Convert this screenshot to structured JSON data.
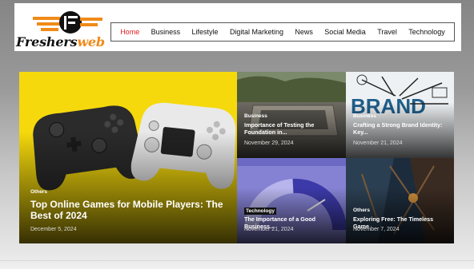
{
  "brand": {
    "name_part1": "Freshers",
    "name_part2": "web"
  },
  "nav": {
    "items": [
      "Home",
      "Business",
      "Lifestyle",
      "Digital Marketing",
      "News",
      "Social Media",
      "Travel",
      "Technology"
    ]
  },
  "featured": {
    "main": {
      "category": "Others",
      "title": "Top Online Games for Mobile Players: The Best of 2024",
      "date": "December 5, 2024"
    },
    "top_mid": {
      "category": "Business",
      "title": "Importance of Testing the Foundation in...",
      "date": "November 29, 2024"
    },
    "top_right": {
      "category": "Business",
      "title": "Crafting a Strong Brand Identity: Key...",
      "date": "November 21, 2024",
      "image_word": "BRAND"
    },
    "bottom_mid": {
      "category": "Technology",
      "title": "The Importance of a Good Business...",
      "date": "November 21, 2024"
    },
    "bottom_right": {
      "category": "Others",
      "title": "Exploring Free: The Timeless Game",
      "date": "November 7, 2024"
    }
  }
}
